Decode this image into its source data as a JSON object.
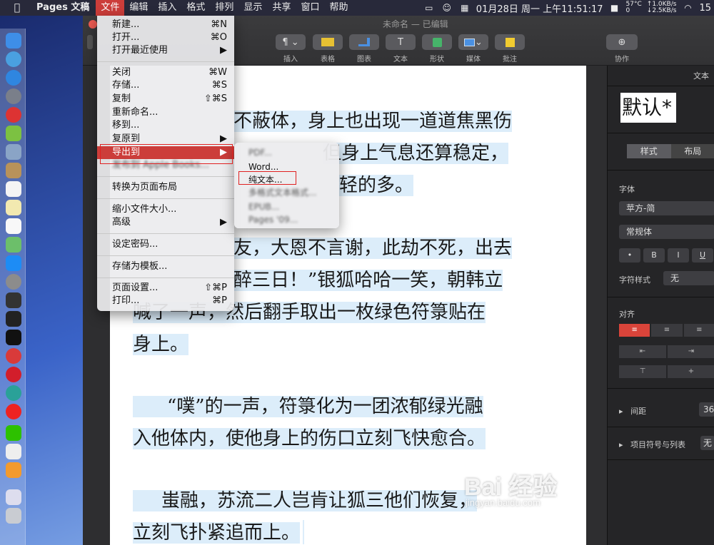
{
  "menubar": {
    "app": "Pages 文稿",
    "items": [
      "文件",
      "编辑",
      "插入",
      "格式",
      "排列",
      "显示",
      "共享",
      "窗口",
      "帮助"
    ],
    "datetime": "01月28日 周一 上午11:51:17",
    "temp": "57°C",
    "fan": "0",
    "net_up": "↑1.0KB/s",
    "net_down": "↓2.5KB/s",
    "battery": "15"
  },
  "window": {
    "title": "未命名 — 已编辑"
  },
  "toolbar": {
    "insert": "插入",
    "table": "表格",
    "chart": "图表",
    "text": "文本",
    "shape": "形状",
    "media": "媒体",
    "comment": "批注",
    "collaborate": "协作"
  },
  "file_menu": {
    "new": "新建...",
    "new_sc": "⌘N",
    "open": "打开...",
    "open_sc": "⌘O",
    "open_recent": "打开最近使用",
    "close": "关闭",
    "close_sc": "⌘W",
    "save": "存储...",
    "save_sc": "⌘S",
    "duplicate": "复制",
    "duplicate_sc": "⇧⌘S",
    "rename": "重新命名...",
    "move": "移到...",
    "revert": "复原到",
    "export": "导出到",
    "publish": "发布到 Apple Books...",
    "convert": "转换为页面布局",
    "reduce": "缩小文件大小...",
    "advanced": "高级",
    "password": "设定密码...",
    "template": "存储为模板...",
    "page_setup": "页面设置...",
    "page_setup_sc": "⇧⌘P",
    "print": "打印...",
    "print_sc": "⌘P"
  },
  "export_submenu": {
    "pdf": "PDF...",
    "word": "Word...",
    "plain_text": "纯文本...",
    "rich_text": "多格式文本格式...",
    "epub": "EPUB...",
    "pages09": "Pages '09..."
  },
  "document": {
    "p1": [
      "不蔽体，身上也出现一道道焦黑伤",
      "但身上气息还算稳定，",
      "轻的多。"
    ],
    "p2": [
      "友，大恩不言谢，此劫不死，出去",
      "醉三日！”银狐哈哈一笑，朝韩立",
      "喊了一声，然后翻手取出一枚绿色符箓贴在",
      "身上。"
    ],
    "p3": [
      "“噗”的一声，符箓化为一团浓郁绿光融",
      "入他体内，使他身上的伤口立刻飞快愈合。"
    ],
    "p4": [
      "蚩融，苏流二人岂肯让狐三他们恢复，",
      "立刻飞扑紧追而上。"
    ]
  },
  "inspector": {
    "tab": "文本",
    "style_name": "默认*",
    "seg_style": "样式",
    "seg_layout": "布局",
    "font_label": "字体",
    "font_family": "苹方-简",
    "font_weight": "常规体",
    "bold": "B",
    "italic": "I",
    "underline": "U",
    "strike": "U",
    "char_style_label": "字符样式",
    "char_style_value": "无",
    "align_label": "对齐",
    "spacing_label": "间距",
    "spacing_value": "36",
    "bullets_label": "项目符号与列表",
    "bullets_value": "无"
  },
  "watermark": {
    "logo": "Bai 经验",
    "url": "jingyan.baidu.com"
  }
}
